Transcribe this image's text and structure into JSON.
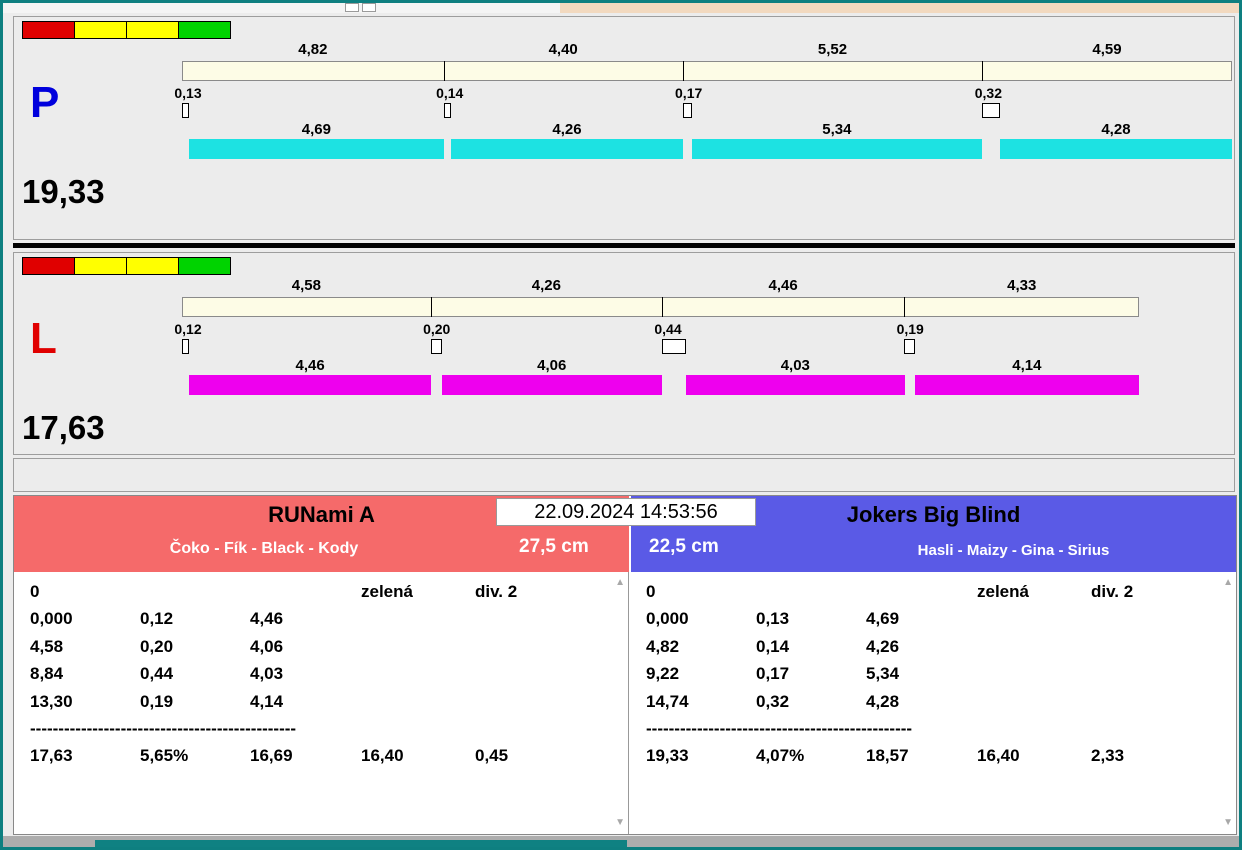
{
  "window": {
    "border_color": "#0e7f80",
    "bg_color": "#ececec",
    "desktop_strip_color": "#f2d9bf",
    "bottom_bar_color": "#adadad",
    "bottom_accent_color": "#0f8182"
  },
  "datetime": "22.09.2024 14:53:56",
  "indicator_lights": [
    "#e00000",
    "#ffff00",
    "#ffff00",
    "#00d300"
  ],
  "lanes": [
    {
      "letter": "P",
      "letter_color": "#0000dd",
      "total": "19,33",
      "splits": [
        "4,82",
        "4,40",
        "5,52",
        "4,59"
      ],
      "crossings": [
        "0,13",
        "0,14",
        "0,17",
        "0,32"
      ],
      "legs": [
        "4,69",
        "4,26",
        "5,34",
        "4,28"
      ],
      "leg_bar_color": "#1de2e2"
    },
    {
      "letter": "L",
      "letter_color": "#e00000",
      "total": "17,63",
      "splits": [
        "4,58",
        "4,26",
        "4,46",
        "4,33"
      ],
      "crossings": [
        "0,12",
        "0,20",
        "0,44",
        "0,19"
      ],
      "legs": [
        "4,46",
        "4,06",
        "4,03",
        "4,14"
      ],
      "leg_bar_color": "#ee00ee"
    }
  ],
  "teams": [
    {
      "name": "RUNami A",
      "dogs": "Čoko - Fík - Black - Kody",
      "jump_height": "27,5 cm",
      "header_color": "#f56a6a",
      "table": {
        "start_value": "0",
        "light_label": "zelená",
        "division_label": "div. 2",
        "rows": [
          [
            "0,000",
            "0,12",
            "4,46"
          ],
          [
            "4,58",
            "0,20",
            "4,06"
          ],
          [
            "8,84",
            "0,44",
            "4,03"
          ],
          [
            "13,30",
            "0,19",
            "4,14"
          ]
        ],
        "separator": "-----------------------------------------------",
        "totals": [
          "17,63",
          "5,65%",
          "16,69",
          "16,40",
          "0,45"
        ]
      }
    },
    {
      "name": "Jokers Big Blind",
      "dogs": "Hasli - Maizy - Gina - Sirius",
      "jump_height": "22,5 cm",
      "header_color": "#5a5ae6",
      "table": {
        "start_value": "0",
        "light_label": "zelená",
        "division_label": "div. 2",
        "rows": [
          [
            "0,000",
            "0,13",
            "4,69"
          ],
          [
            "4,82",
            "0,14",
            "4,26"
          ],
          [
            "9,22",
            "0,17",
            "5,34"
          ],
          [
            "14,74",
            "0,32",
            "4,28"
          ]
        ],
        "separator": "-----------------------------------------------",
        "totals": [
          "19,33",
          "4,07%",
          "18,57",
          "16,40",
          "2,33"
        ]
      }
    }
  ]
}
